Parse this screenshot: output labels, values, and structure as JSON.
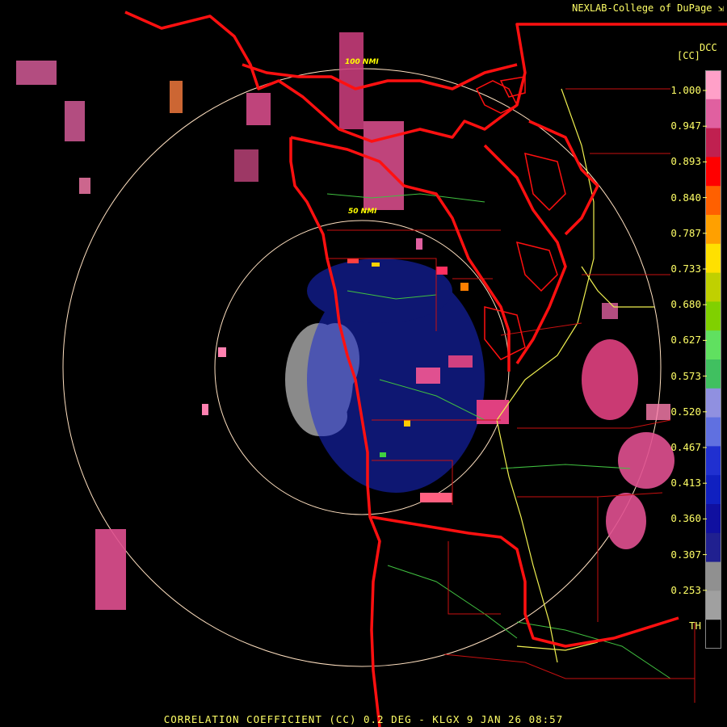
{
  "credit": "NEXLAB-College of DuPage",
  "footer": "CORRELATION COEFFICIENT (CC) 0.2 DEG - KLGX 9 JAN 26 08:57",
  "range_rings": [
    "50 NMI",
    "100 NMI"
  ],
  "legend": {
    "code": "DCC",
    "unit": "[CC]",
    "ticks": [
      "1.000",
      "0.947",
      "0.893",
      "0.840",
      "0.787",
      "0.733",
      "0.680",
      "0.627",
      "0.573",
      "0.520",
      "0.467",
      "0.413",
      "0.360",
      "0.307",
      "0.253",
      "TH"
    ],
    "colors": [
      "#ffa0c8",
      "#e060a0",
      "#c02050",
      "#ff0000",
      "#ff6000",
      "#ffa000",
      "#ffe000",
      "#c0d000",
      "#80d000",
      "#60e060",
      "#40c060",
      "#9090e0",
      "#6070e0",
      "#2030d0",
      "#1020c0",
      "#1010a0",
      "#202090",
      "#909090",
      "#a0a0a0",
      "#000000"
    ]
  },
  "colors": {
    "background": "#000000",
    "state_borders": "#ff1010",
    "county_lines": "#c81010",
    "highways": "#f0f050",
    "rivers": "#40c040",
    "range_rings": "#ffe0c0",
    "label_text": "#ffff66"
  }
}
